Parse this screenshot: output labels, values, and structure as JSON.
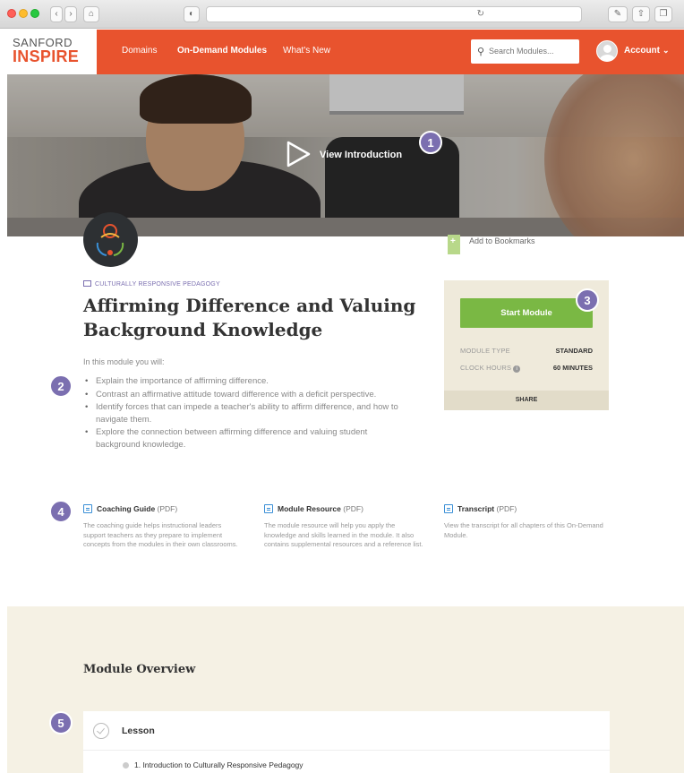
{
  "brand": {
    "line1": "SANFORD",
    "line2": "INSPIRE",
    "accent_color": "#e8532e"
  },
  "nav": {
    "items": [
      "Domains",
      "On-Demand Modules",
      "What's New"
    ]
  },
  "search": {
    "placeholder": "Search Modules..."
  },
  "account": {
    "label": "Account"
  },
  "hero": {
    "play_label": "View Introduction"
  },
  "callouts": [
    "1",
    "2",
    "3",
    "4",
    "5"
  ],
  "bookmark": {
    "label": "Add to Bookmarks"
  },
  "module": {
    "category": "CULTURALLY RESPONSIVE PEDAGOGY",
    "title": "Affirming Difference and Valuing Background Knowledge",
    "intro": "In this module you will:",
    "objectives": [
      "Explain the importance of affirming difference.",
      "Contrast an affirmative attitude toward difference with a deficit perspective.",
      "Identify forces that can impede a teacher's ability to affirm difference, and how to navigate them.",
      "Explore the connection between affirming difference and valuing student background knowledge."
    ]
  },
  "card": {
    "start_label": "Start Module",
    "type_label": "MODULE TYPE",
    "type_value": "STANDARD",
    "hours_label": "CLOCK HOURS",
    "hours_value": "60 MINUTES",
    "share_label": "SHARE",
    "button_color": "#7ab844"
  },
  "resources": [
    {
      "title": "Coaching Guide",
      "suffix": "(PDF)",
      "description": "The coaching guide helps instructional leaders support teachers as they prepare to implement concepts from the modules in their own classrooms."
    },
    {
      "title": "Module Resource",
      "suffix": "(PDF)",
      "description": "The module resource will help you apply the knowledge and skills learned in the module. It also contains supplemental resources and a reference list."
    },
    {
      "title": "Transcript",
      "suffix": "(PDF)",
      "description": "View the transcript for all chapters of this On-Demand Module."
    }
  ],
  "overview": {
    "title": "Module Overview",
    "lesson_label": "Lesson",
    "items": [
      "1. Introduction to Culturally Responsive Pedagogy"
    ]
  }
}
